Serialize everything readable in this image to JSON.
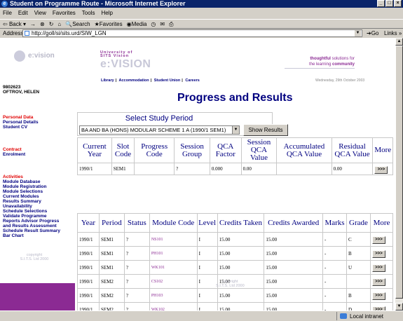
{
  "window": {
    "title": "Student on Programme Route - Microsoft Internet Explorer"
  },
  "menu": [
    "File",
    "Edit",
    "View",
    "Favorites",
    "Tools",
    "Help"
  ],
  "toolbar": {
    "back": "Back",
    "forward": "→",
    "stop": "⊗",
    "refresh": "↻",
    "home": "⌂",
    "search": "Search",
    "favorites": "Favorites",
    "media": "Media",
    "history": "◷",
    "mail": "✉",
    "print": "⎙"
  },
  "address": {
    "label": "Address",
    "url": "http://goll/si/sits.urd/SIW_LGN",
    "go": "Go",
    "links": "Links"
  },
  "status": {
    "text": "",
    "zone": "Local intranet"
  },
  "sidebar": {
    "logo_text": "e:vision",
    "student_id": "9802623",
    "student_name": "OFTROV, HELEN",
    "personal_data_heading": "Personal Data",
    "personal_items": [
      "Personal Details",
      "Student CV"
    ],
    "contract_heading": "Contract",
    "contract_items": [
      "Enrolment"
    ],
    "activities_heading": "Activities",
    "activity_items": [
      "Module Database",
      "Module Registration",
      "Module Selections",
      "Current Modules",
      "Results Summary",
      "Unavailability",
      "Schedule Selections",
      "Validate Programme",
      "Reports Advisor Progress",
      "and Results Assessment",
      "Schedule Result Summary",
      "Bar Chart"
    ],
    "copyright": [
      "copyright",
      "S.I.T.S. Ltd 2000"
    ]
  },
  "header": {
    "uni_line1": "University of",
    "uni_line2": "SITS Vision",
    "uni_logo": "e:VISION",
    "thought_1": "thoughtful",
    "thought_2": "solutions for",
    "thought_3": "the learning",
    "thought_4": "community",
    "nav": [
      "Library",
      "Accommodation",
      "Student Union",
      "Careers"
    ],
    "date": "Wednesday, 29th October 2003"
  },
  "page_title": "Progress and Results",
  "study_period": {
    "heading": "Select Study Period",
    "selected": "BA AND BA (HONS) MODULAR SCHEME 1 A (1990/1 SEM1)",
    "button": "Show Results"
  },
  "progress_table": {
    "headers": [
      "Current Year",
      "Slot Code",
      "Progress Code",
      "Session Group",
      "QCA Factor",
      "Session QCA Value",
      "Accumulated QCA Value",
      "Residual QCA Value",
      "More"
    ],
    "rows": [
      [
        "1990/1",
        "SEM1",
        "",
        "?",
        "0.000",
        "0.00",
        "",
        "0.00",
        ">>>"
      ]
    ]
  },
  "results_table": {
    "headers": [
      "Year",
      "Period",
      "Status",
      "Module Code",
      "Level",
      "Credits Taken",
      "Credits Awarded",
      "Marks",
      "Grade",
      "More"
    ],
    "rows": [
      [
        "1990/1",
        "SEM1",
        "?",
        "NS101",
        "I",
        "15.00",
        "15.00",
        "-",
        "C",
        ">>>"
      ],
      [
        "1990/1",
        "SEM1",
        "?",
        "PH101",
        "I",
        "15.00",
        "15.00",
        "-",
        "B",
        ">>>"
      ],
      [
        "1990/1",
        "SEM1",
        "?",
        "WK101",
        "I",
        "15.00",
        "15.00",
        "-",
        "U",
        ">>>"
      ],
      [
        "1990/1",
        "SEM2",
        "?",
        "CS102",
        "I",
        "15.00",
        "15.00",
        "-",
        "",
        ">>>"
      ],
      [
        "1990/1",
        "SEM2",
        "?",
        "PH103",
        "I",
        "15.00",
        "15.00",
        "-",
        "B",
        ">>>"
      ],
      [
        "1990/1",
        "SEM2",
        "?",
        "WK102",
        "I",
        "15.00",
        "15.00",
        "-",
        "D",
        ">>>"
      ]
    ]
  },
  "footer_copyright": [
    "copyright",
    "S.I.T.S. Ltd 2000"
  ]
}
